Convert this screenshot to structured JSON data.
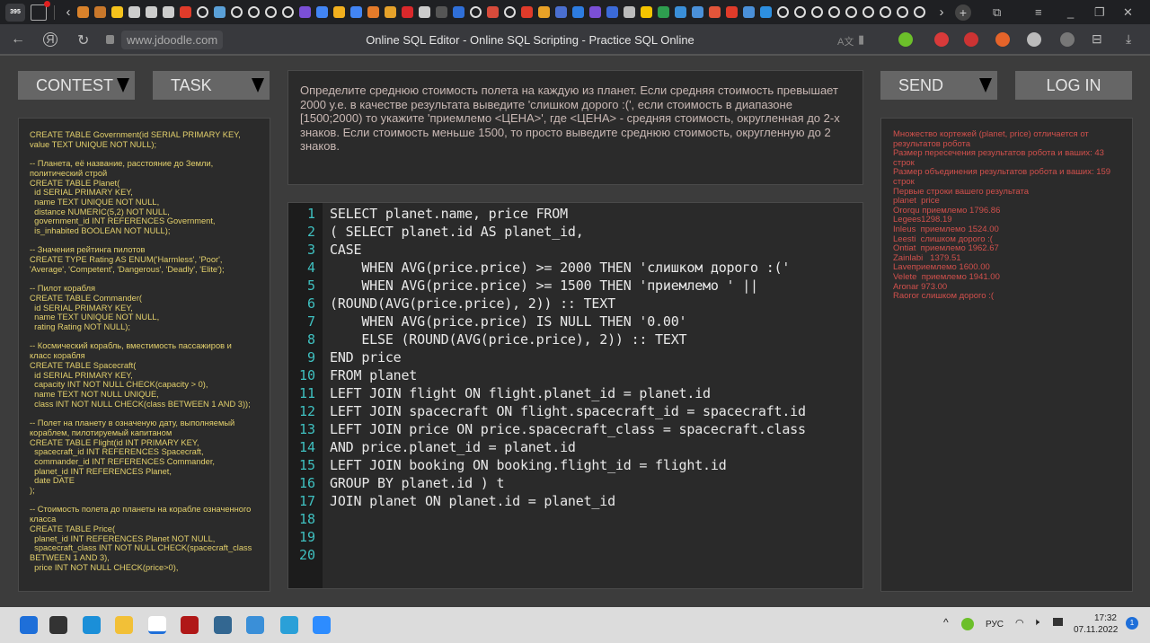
{
  "browser": {
    "tab_count": "395",
    "favicons": [
      {
        "name": "orange-icon",
        "color": "#d9822b"
      },
      {
        "name": "orange-icon",
        "color": "#c9782b"
      },
      {
        "name": "image-icon",
        "color": "#f4c21c"
      },
      {
        "name": "page-icon",
        "color": "#ccc"
      },
      {
        "name": "page-icon",
        "color": "#ccc"
      },
      {
        "name": "page-icon",
        "color": "#ccc"
      },
      {
        "name": "yandex-icon",
        "color": "#e03b2a"
      },
      {
        "name": "github-icon",
        "color": "gh"
      },
      {
        "name": "doc-icon",
        "color": "#5aa0d8"
      },
      {
        "name": "github-icon",
        "color": "gh"
      },
      {
        "name": "github-icon",
        "color": "gh"
      },
      {
        "name": "github-icon",
        "color": "gh"
      },
      {
        "name": "github-icon",
        "color": "gh"
      },
      {
        "name": "question-icon",
        "color": "#7b4fd6"
      },
      {
        "name": "google-icon",
        "color": "#4285f4"
      },
      {
        "name": "bolt-icon",
        "color": "#f2b01e"
      },
      {
        "name": "google-icon",
        "color": "#4285f4"
      },
      {
        "name": "stack-icon",
        "color": "#e57b2a"
      },
      {
        "name": "star-icon",
        "color": "#e5a12a"
      },
      {
        "name": "red-square-icon",
        "color": "#d9282b"
      },
      {
        "name": "page-icon",
        "color": "#ccc"
      },
      {
        "name": "trash-icon",
        "color": "#555"
      },
      {
        "name": "blue-icon",
        "color": "#2f6fd8"
      },
      {
        "name": "github-icon",
        "color": "gh"
      },
      {
        "name": "gmail-icon",
        "color": "#d84b3b"
      },
      {
        "name": "github-icon",
        "color": "gh"
      },
      {
        "name": "yandex-icon",
        "color": "#e03b2a"
      },
      {
        "name": "sun-icon",
        "color": "#e9a227"
      },
      {
        "name": "code-icon",
        "color": "#4a6fd0"
      },
      {
        "name": "blue-dot-icon",
        "color": "#2d7ce0"
      },
      {
        "name": "purple-icon",
        "color": "#7b4fd6"
      },
      {
        "name": "play-icon",
        "color": "#3b6ad8"
      },
      {
        "name": "send-icon",
        "color": "#bbb"
      },
      {
        "name": "beeline-icon",
        "color": "#f5c400"
      },
      {
        "name": "excel-icon",
        "color": "#2e9e4f"
      },
      {
        "name": "chart-icon",
        "color": "#3a8fd8"
      },
      {
        "name": "doc-icon",
        "color": "#4a90d9"
      },
      {
        "name": "figma-icon",
        "color": "#e2553a"
      },
      {
        "name": "yandex-icon",
        "color": "#e03b2a"
      },
      {
        "name": "doc-icon",
        "color": "#4a90d9"
      },
      {
        "name": "bird-icon",
        "color": "#2d8fe0"
      },
      {
        "name": "circle-icon",
        "color": "gh"
      },
      {
        "name": "github-icon",
        "color": "gh"
      },
      {
        "name": "github-icon",
        "color": "gh"
      },
      {
        "name": "github-icon",
        "color": "gh"
      },
      {
        "name": "github-icon",
        "color": "gh"
      },
      {
        "name": "github-icon",
        "color": "gh"
      },
      {
        "name": "github-icon",
        "color": "gh"
      },
      {
        "name": "github-icon",
        "color": "gh"
      },
      {
        "name": "github-icon",
        "color": "gh"
      }
    ],
    "url": "www.jdoodle.com",
    "title": "Online SQL Editor - Online SQL Scripting - Practice SQL Online",
    "extensions": [
      {
        "name": "download-arrow-icon",
        "color": "#6cbf2a"
      },
      {
        "name": "adblock-icon",
        "color": "#d83a3a"
      },
      {
        "name": "extension-icon",
        "color": "#c33"
      },
      {
        "name": "fire-icon",
        "color": "#e5642a"
      },
      {
        "name": "globe-icon",
        "color": "#bbb"
      },
      {
        "name": "sun-icon",
        "color": "#777"
      }
    ]
  },
  "buttons": {
    "contest": "CONTEST",
    "task": "TASK",
    "send": "SEND",
    "login": "LOG IN"
  },
  "schema": "CREATE TABLE Government(id SERIAL PRIMARY KEY,\nvalue TEXT UNIQUE NOT NULL);\n\n-- Планета, её название, расстояние до Земли,\nполитический строй\nCREATE TABLE Planet(\n  id SERIAL PRIMARY KEY,\n  name TEXT UNIQUE NOT NULL,\n  distance NUMERIC(5,2) NOT NULL,\n  government_id INT REFERENCES Government,\n  is_inhabited BOOLEAN NOT NULL);\n\n-- Значения рейтинга пилотов\nCREATE TYPE Rating AS ENUM('Harmless', 'Poor',\n'Average', 'Competent', 'Dangerous', 'Deadly', 'Elite');\n\n-- Пилот корабля\nCREATE TABLE Commander(\n  id SERIAL PRIMARY KEY,\n  name TEXT UNIQUE NOT NULL,\n  rating Rating NOT NULL);\n\n-- Космический корабль, вместимость пассажиров и\nкласс корабля\nCREATE TABLE Spacecraft(\n  id SERIAL PRIMARY KEY,\n  capacity INT NOT NULL CHECK(capacity > 0),\n  name TEXT NOT NULL UNIQUE,\n  class INT NOT NULL CHECK(class BETWEEN 1 AND 3));\n\n-- Полет на планету в означеную дату, выполняемый\nкораблем, пилотируемый капитаном\nCREATE TABLE Flight(id INT PRIMARY KEY,\n  spacecraft_id INT REFERENCES Spacecraft,\n  commander_id INT REFERENCES Commander,\n  planet_id INT REFERENCES Planet,\n  date DATE\n);\n\n-- Стоимость полета до планеты на корабле означенного\nкласса\nCREATE TABLE Price(\n  planet_id INT REFERENCES Planet NOT NULL,\n  spacecraft_class INT NOT NULL CHECK(spacecraft_class\nBETWEEN 1 AND 3),\n  price INT NOT NULL CHECK(price>0),",
  "task_text": "Определите среднюю стоимость полета на каждую из планет. Если средняя стоимость превышает 2000 у.е. в качестве результата выведите 'слишком дорого :(', если стоимость в диапазоне [1500;2000) то укажите 'приемлемо <ЦЕНА>', где <ЦЕНА> - средняя стоимость, округленная до 2-х знаков. Если стоимость меньше 1500, то просто выведите среднюю стоимость, округленную до 2 знаков.",
  "code_lines": [
    "SELECT planet.name, price FROM",
    "( SELECT planet.id AS planet_id,",
    "CASE",
    "    WHEN AVG(price.price) >= 2000 THEN 'слишком дорого :('",
    "    WHEN AVG(price.price) >= 1500 THEN 'приемлемо ' ||",
    "(ROUND(AVG(price.price), 2)) :: TEXT",
    "    WHEN AVG(price.price) IS NULL THEN '0.00'",
    "    ELSE (ROUND(AVG(price.price), 2)) :: TEXT",
    "END price",
    "FROM planet",
    "LEFT JOIN flight ON flight.planet_id = planet.id",
    "LEFT JOIN spacecraft ON flight.spacecraft_id = spacecraft.id",
    "LEFT JOIN price ON price.spacecraft_class = spacecraft.class",
    "AND price.planet_id = planet.id",
    "LEFT JOIN booking ON booking.flight_id = flight.id",
    "GROUP BY planet.id ) t",
    "JOIN planet ON planet.id = planet_id",
    "",
    "",
    ""
  ],
  "result": "Множество кортежей (planet, price) отличается от\nрезультатов робота\nРазмер пересечения результатов робота и ваших: 43\nстрок\nРазмер объединения результатов робота и ваших: 159\nстрок\nПервые строки вашего результата\nplanet  price\nOrorqu приемлемо 1796.86\nLegees1298.19\nInleus  приемлемо 1524.00\nLeesti  слишком дорого :(\nOntiat  приемлемо 1962.67\nZainlabi   1379.51\nLaveприемлемо 1600.00\nVelete  приемлемо 1941.00\nAronar 973.00\nRaoror слишком дорого :(",
  "taskbar": {
    "apps": [
      {
        "name": "start-icon",
        "color": "#1e6fd9"
      },
      {
        "name": "search-icon",
        "color": "#333"
      },
      {
        "name": "edge-icon",
        "color": "#1b8fd8"
      },
      {
        "name": "explorer-icon",
        "color": "#f2c037"
      },
      {
        "name": "yandex-browser-icon",
        "color": "#e02020"
      },
      {
        "name": "app-icon",
        "color": "#b01818"
      },
      {
        "name": "pgadmin-icon",
        "color": "#336791"
      },
      {
        "name": "notepad-icon",
        "color": "#3a8fd8"
      },
      {
        "name": "telegram-icon",
        "color": "#2aa0d8"
      },
      {
        "name": "zoom-icon",
        "color": "#2d8cff"
      }
    ],
    "lang": "РУС",
    "time": "17:32",
    "date": "07.11.2022",
    "notifications": "1"
  },
  "colors": {
    "schema_text": "#e3d06c",
    "result_text": "#d1504c",
    "line_numbers": "#3fc0c0"
  }
}
